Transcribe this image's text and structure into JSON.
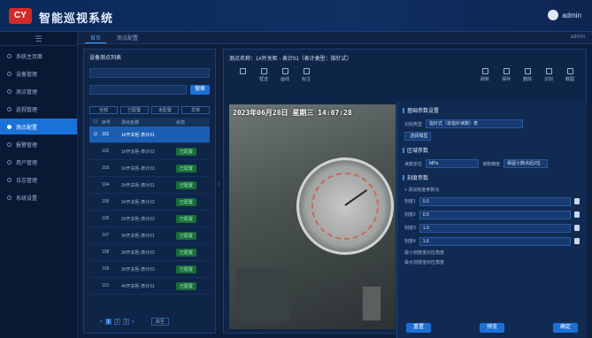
{
  "header": {
    "app_title": "智能巡视系统",
    "user_name": "admin"
  },
  "tabs": [
    {
      "label": "首页"
    },
    {
      "label": "测点配置"
    }
  ],
  "tab_right_label": "admin",
  "sidebar": {
    "toggle_icon": "menu-icon",
    "items": [
      {
        "label": "系统主页面"
      },
      {
        "label": "设备管理"
      },
      {
        "label": "测点管理"
      },
      {
        "label": "巡视管理"
      },
      {
        "label": "测点配置"
      },
      {
        "label": "报警管理"
      },
      {
        "label": "用户管理"
      },
      {
        "label": "日志管理"
      },
      {
        "label": "系统设置"
      }
    ]
  },
  "left_panel": {
    "title": "设备测点列表",
    "search_button": "搜索",
    "chips": [
      "全部",
      "已配置",
      "未配置",
      "异常"
    ],
    "table_headers": [
      "",
      "序号",
      "测点名称",
      "状态"
    ],
    "rows": [
      {
        "idx": "",
        "no": "101",
        "name": "1#开关柜-表计01",
        "status": ""
      },
      {
        "idx": "",
        "no": "102",
        "name": "1#开关柜-表计02",
        "status": "已配置"
      },
      {
        "idx": "",
        "no": "103",
        "name": "1#开关柜-表计03",
        "status": "已配置"
      },
      {
        "idx": "",
        "no": "104",
        "name": "2#开关柜-表计01",
        "status": "已配置"
      },
      {
        "idx": "",
        "no": "105",
        "name": "2#开关柜-表计02",
        "status": "已配置"
      },
      {
        "idx": "",
        "no": "106",
        "name": "2#开关柜-表计03",
        "status": "已配置"
      },
      {
        "idx": "",
        "no": "107",
        "name": "3#开关柜-表计01",
        "status": "已配置"
      },
      {
        "idx": "",
        "no": "108",
        "name": "3#开关柜-表计02",
        "status": "已配置"
      },
      {
        "idx": "",
        "no": "109",
        "name": "3#开关柜-表计03",
        "status": "已配置"
      },
      {
        "idx": "",
        "no": "110",
        "name": "4#开关柜-表计01",
        "status": "已配置"
      }
    ],
    "pager": {
      "prev": "<",
      "pages": [
        "1",
        "2",
        "3"
      ],
      "next": ">",
      "goto_label": "跳至"
    }
  },
  "center": {
    "title": "测点名称：1#开关柜 - 表计01（表计类型：指针式）",
    "tools_left": [
      {
        "label": "",
        "icon": "save-icon"
      },
      {
        "label": "框选",
        "icon": "select-icon"
      },
      {
        "label": "画线",
        "icon": "line-icon"
      },
      {
        "label": "标注",
        "icon": "tag-icon"
      }
    ],
    "tools_right": [
      {
        "label": "刷新",
        "icon": "refresh-icon"
      },
      {
        "label": "保存",
        "icon": "save-icon"
      },
      {
        "label": "删除",
        "icon": "delete-icon"
      },
      {
        "label": "识别",
        "icon": "recognize-icon"
      },
      {
        "label": "截图",
        "icon": "snapshot-icon"
      }
    ],
    "osd_text": "2023年06月28日 星期三 14:07:28",
    "collapse_icon": "chevron-left-icon"
  },
  "right_panel": {
    "sec1_title": "基础参数设置",
    "sec1_field_label": "识别类型",
    "sec1_field_value": "指针式（单指针读数）表",
    "sec1_button": "选择模型",
    "sec2_title": "区域参数",
    "sec2_field1_label": "读数单位",
    "sec2_field1_value": "MPa",
    "sec2_field2_label": "读数精度",
    "sec2_field2_value": "保留小数点后2位",
    "sec3_title": "刻度参数",
    "sec3_sub": "+ 添加刻度参数点",
    "params": [
      {
        "label": "刻度1",
        "value": "0.0"
      },
      {
        "label": "刻度2",
        "value": "0.5"
      },
      {
        "label": "刻度3",
        "value": "1.0"
      },
      {
        "label": "刻度4",
        "value": "1.6"
      }
    ],
    "extra1": "最小刻度值对应角度",
    "extra2": "最大刻度值对应角度",
    "footer": {
      "reset": "重置",
      "preview": "预览",
      "confirm": "确定"
    }
  }
}
